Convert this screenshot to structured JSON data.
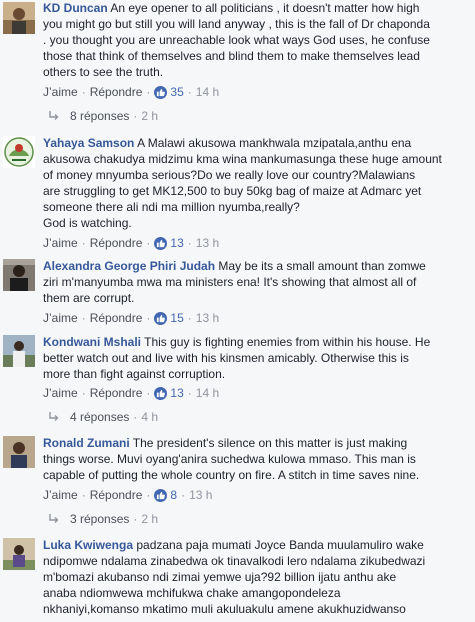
{
  "labels": {
    "like": "J’aime",
    "reply": "Répondre",
    "dot": "·"
  },
  "colors": {
    "author": "#365899",
    "like_blue": "#4267b2",
    "meta": "#90949c"
  },
  "comments": [
    {
      "author": "KD Duncan",
      "lines": [
        " An eye opener to all politicians , it doesn't matter how high",
        "you might go but still you will land anyway , this is the fall of Dr chaponda",
        ". you thought you are unreachable look what ways God uses, he confuse",
        "those that think of themselves and blind them to make themselves lead",
        "others to see the truth."
      ],
      "likes": "35",
      "time": "14 h",
      "replies": {
        "label": "8 réponses",
        "time": "2 h"
      }
    },
    {
      "author": "Yahaya Samson",
      "lines": [
        " A Malawi akusowa mankhwala mzipatala,anthu ena",
        "akusowa chakudya midzimu kma wina mankumasunga these huge amount",
        "of money mnyumba serious?Do we really love our country?Malawians",
        "are struggling to get MK12,500 to buy 50kg bag of maize at Admarc yet",
        "someone there ali ndi ma million nyumba,really?",
        "God is watching."
      ],
      "likes": "13",
      "time": "13 h"
    },
    {
      "author": "Alexandra George Phiri Judah",
      "lines": [
        " May be its a small amount than zomwe",
        "ziri m'manyumba mwa ma ministers ena! It's showing that almost all of",
        "them are corrupt."
      ],
      "likes": "15",
      "time": "13 h"
    },
    {
      "author": "Kondwani Mshali",
      "lines": [
        " This guy is fighting enemies from within his house. He",
        "better watch out and live with his kinsmen amicably. Otherwise this is",
        "more than fight against corruption."
      ],
      "likes": "13",
      "time": "14 h",
      "replies": {
        "label": "4 réponses",
        "time": "4 h"
      }
    },
    {
      "author": "Ronald Zumani",
      "lines": [
        " The president's silence on this matter is just making",
        "things worse. Muvi oyang'anira suchedwa kulowa mmaso. This man is",
        "capable of putting the whole country on fire. A stitch in time saves nine."
      ],
      "likes": "8",
      "time": "13 h",
      "replies": {
        "label": "3 réponses",
        "time": "2 h"
      }
    },
    {
      "author": "Luka Kwiwenga",
      "lines": [
        " padzana paja mumati Joyce Banda muulamuliro wake",
        "ndipomwe ndalama zinabedwa ok tinavalkodi lero ndalama zikubedwazi",
        "m'bomazi akubanso ndi zimai yemwe uja?92 billion ijatu anthu ake",
        "anaba ndiomwewa mchifukwa chake amangopondeleza",
        "nkhaniyi,komanso mkatimo muli akuluakulu amene akukhuzidwanso"
      ]
    }
  ]
}
